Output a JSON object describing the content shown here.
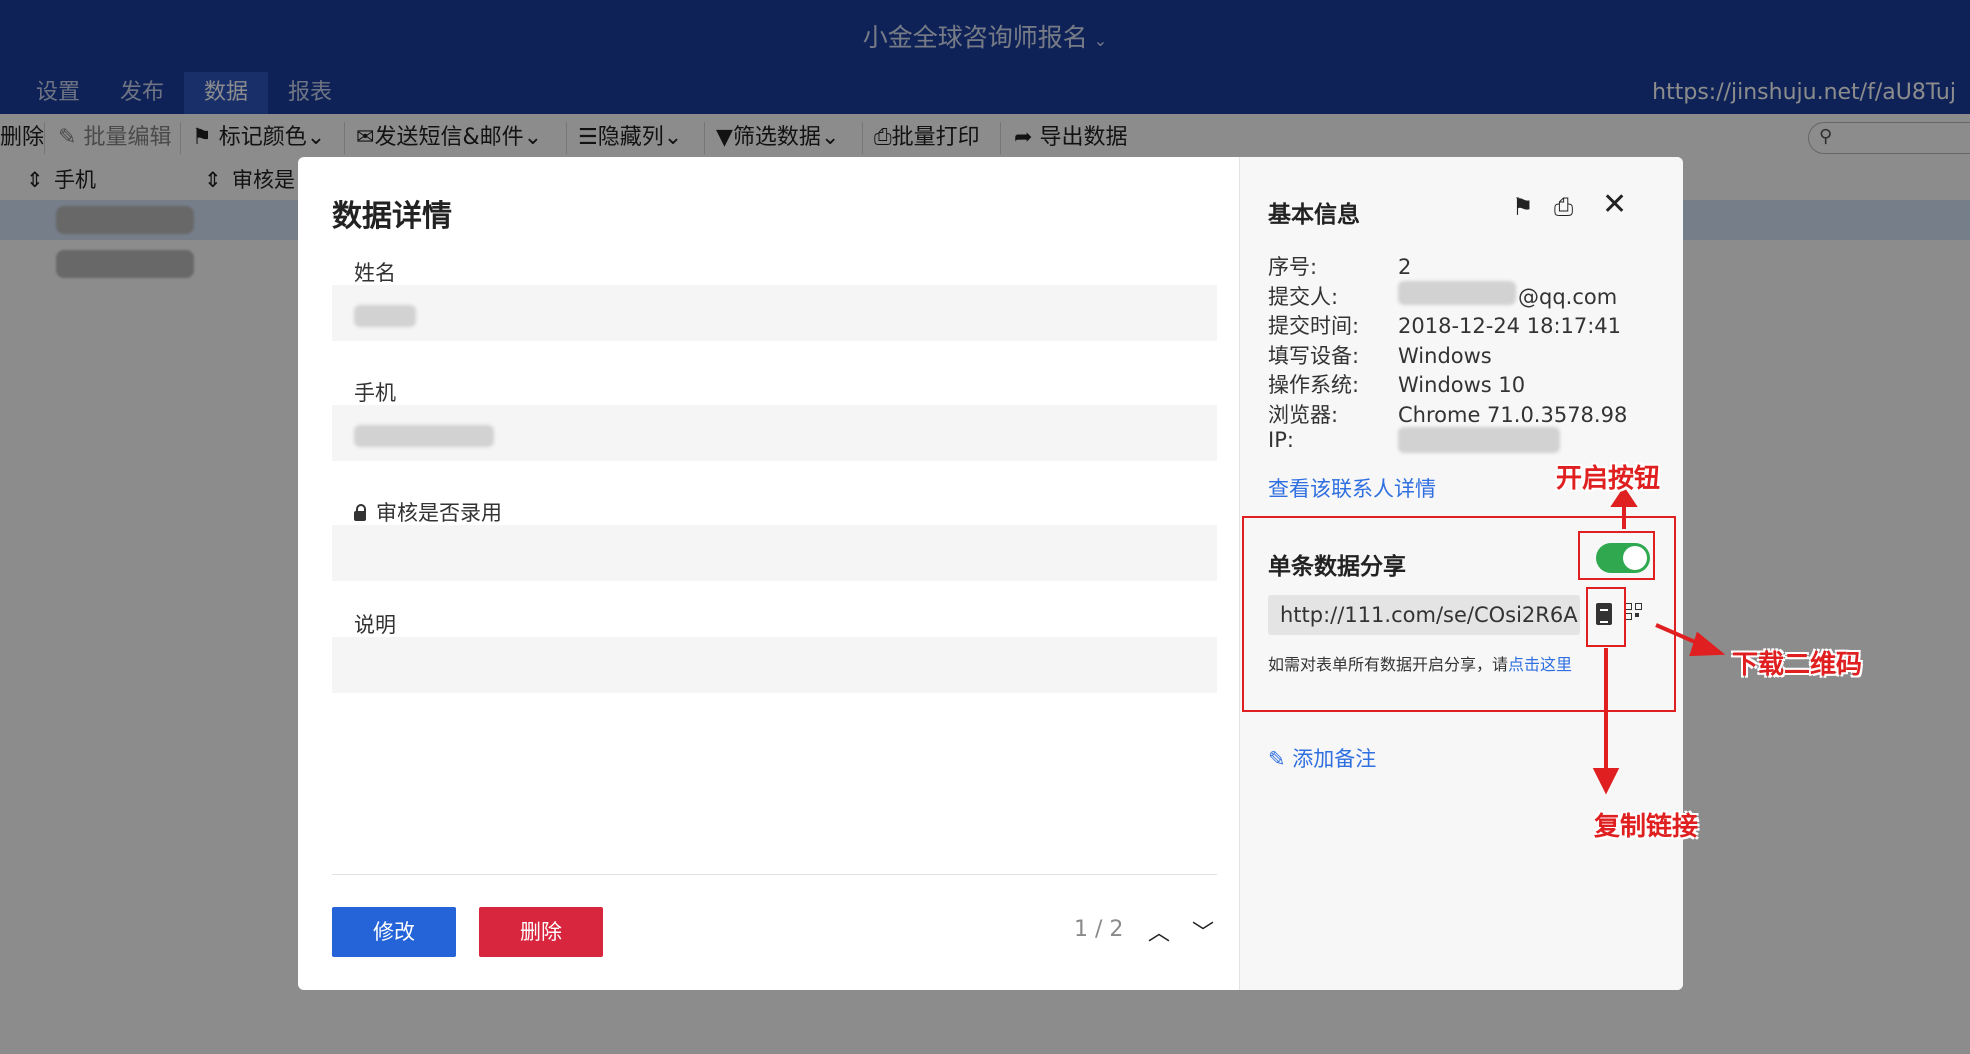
{
  "header": {
    "form_title": "小金全球咨询师报名",
    "tabs": [
      {
        "label": "设置"
      },
      {
        "label": "发布"
      },
      {
        "label": "数据"
      },
      {
        "label": "报表"
      }
    ],
    "url": "https://jinshuju.net/f/aU8Tuj"
  },
  "toolbar": {
    "delete": "删除",
    "batch_edit": "批量编辑",
    "mark_color": "标记颜色",
    "send_sms": "发送短信&邮件",
    "hide_cols": "隐藏列",
    "filter": "筛选数据",
    "batch_print": "批量打印",
    "export": "导出数据"
  },
  "table": {
    "columns": [
      "手机",
      "审核是"
    ]
  },
  "modal": {
    "title": "数据详情",
    "fields": [
      {
        "label": "姓名"
      },
      {
        "label": "手机"
      },
      {
        "label": "审核是否录用"
      },
      {
        "label": "说明"
      }
    ],
    "edit_button": "修改",
    "delete_button": "删除",
    "pager": "1 / 2"
  },
  "info": {
    "title": "基本信息",
    "rows": [
      {
        "key": "序号:",
        "value": "2"
      },
      {
        "key": "提交人:",
        "value": "@qq.com"
      },
      {
        "key": "提交时间:",
        "value": "2018-12-24 18:17:41"
      },
      {
        "key": "填写设备:",
        "value": "Windows"
      },
      {
        "key": "操作系统:",
        "value": "Windows 10"
      },
      {
        "key": "浏览器:",
        "value": "Chrome 71.0.3578.98"
      },
      {
        "key": "IP:",
        "value": ""
      }
    ],
    "contact_link": "查看该联系人详情"
  },
  "share": {
    "title": "单条数据分享",
    "enabled": true,
    "url": "http://111.com/se/COsi2R6A",
    "tip_text": "如需对表单所有数据开启分享，请",
    "tip_link": "点击这里"
  },
  "add_note": "添加备注",
  "annotations": {
    "toggle": "开启按钮",
    "qr": "下载二维码",
    "copy": "复制链接"
  },
  "colors": {
    "header_bg": "#1a3f9e",
    "active_tab": "#2c56c2",
    "primary": "#2563d9",
    "danger": "#d7263d",
    "toggle_on": "#2fa84f",
    "annotation": "#e02020"
  }
}
